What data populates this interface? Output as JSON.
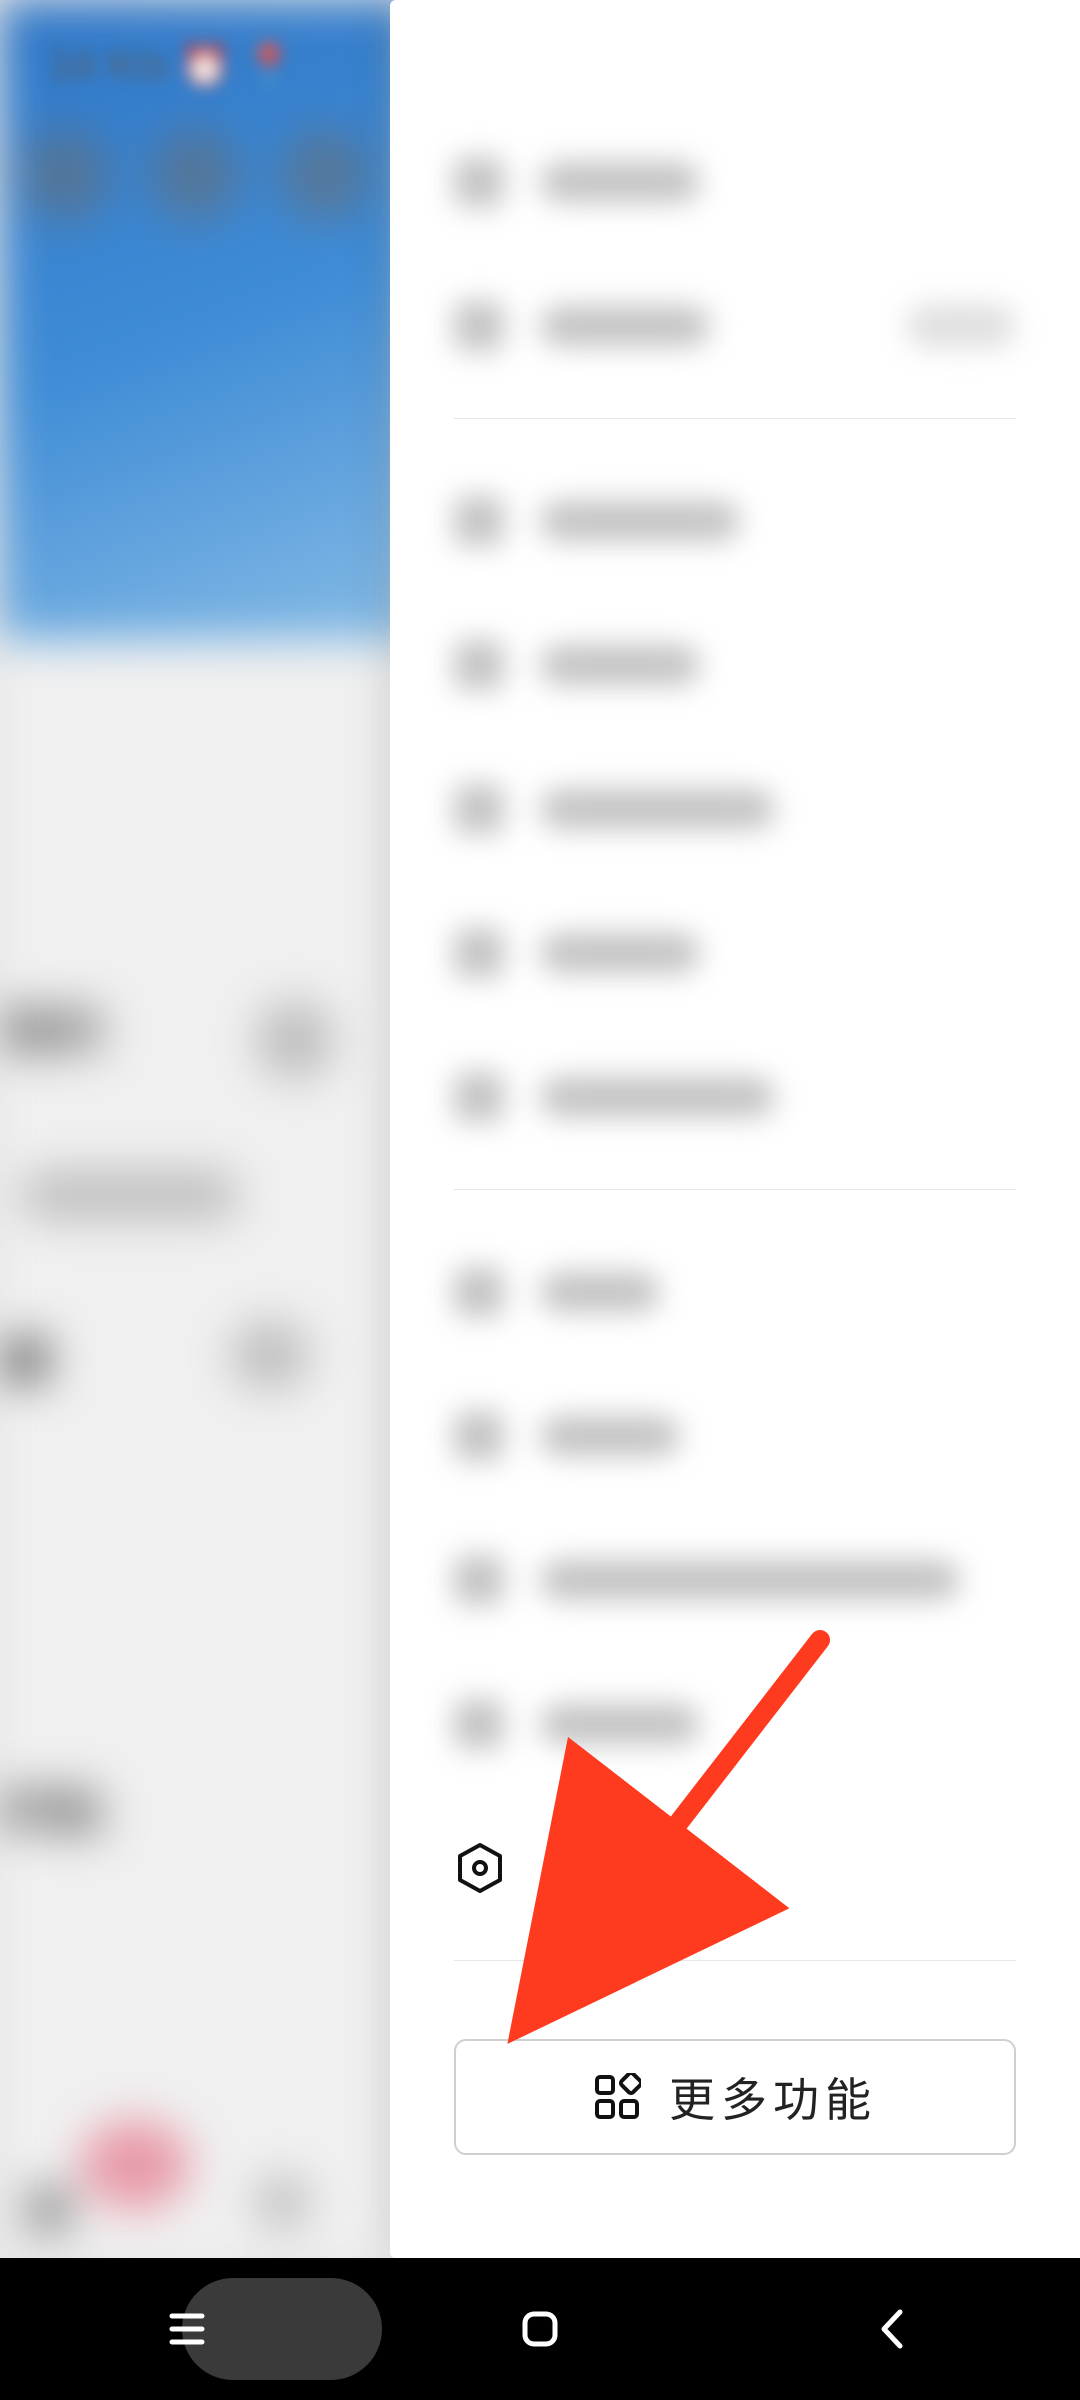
{
  "statusbar": {
    "time": "14",
    "speed": "K/s",
    "right_text": "Sat 5"
  },
  "left_background": {
    "t1": "我的",
    "t2": "藏",
    "t3": "的贴",
    "t4": "消"
  },
  "drawer": {
    "settings_label": "设置",
    "more_label": "更多功能"
  },
  "nav": {
    "recents": "recents",
    "home": "home",
    "back": "back"
  },
  "colors": {
    "arrow": "#ff3b1f",
    "accent_green": "#3bbf4e"
  }
}
